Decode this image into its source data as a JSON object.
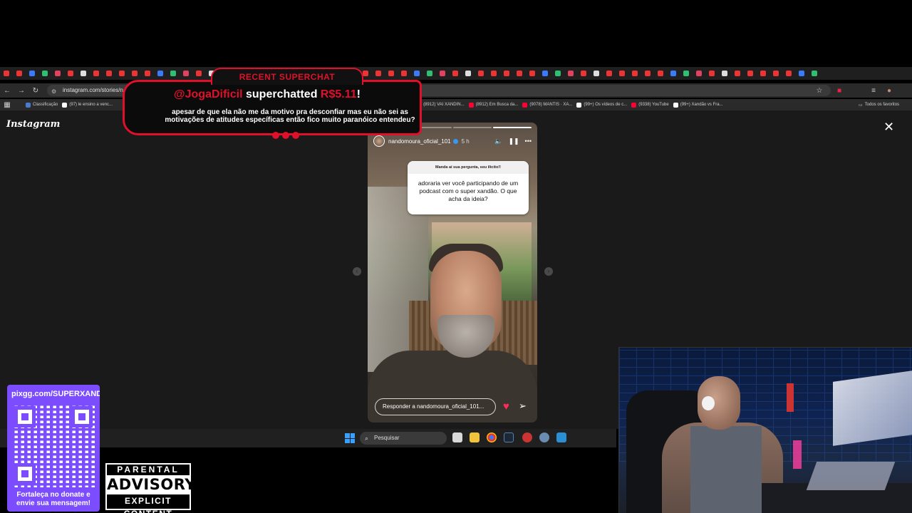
{
  "browser": {
    "url": "instagram.com/stories/n",
    "bookmarks": [
      {
        "label": "Classificação",
        "color": "#4a7bd0"
      },
      {
        "label": "(97) le ensino a venc...",
        "color": "#ffffff"
      },
      {
        "label": "(8912) VAI XANDIN...",
        "color": "#ff0033"
      },
      {
        "label": "(8912) Em Busca da...",
        "color": "#ff0033"
      },
      {
        "label": "(9078) MANTIS · XA...",
        "color": "#ff0033"
      },
      {
        "label": "(99+) Os vídeos de c...",
        "color": "#ffffff"
      },
      {
        "label": "(9338) YouTube",
        "color": "#ff0033"
      },
      {
        "label": "(99+) Xandão vs Fra...",
        "color": "#ffffff"
      }
    ],
    "all_bookmarks": "Todos os favoritos"
  },
  "instagram": {
    "logo": "Instagram",
    "close_icon": "✕",
    "story": {
      "username": "nandomoura_oficial_101",
      "time": "5 h",
      "question_header": "Manda aí sua pergunta, seu iltcito!!",
      "question_text": "adoraria ver você participando de um podcast com o super xandão. O que acha da ideia?",
      "reply_placeholder": "Responder a nandomoura_oficial_101..."
    }
  },
  "superchat": {
    "header": "RECENT SUPERCHAT",
    "user": "@JogaDificil",
    "verb": "superchatted",
    "amount": "R$5.11",
    "exclaim": "!",
    "message": "apesar de que ela não me da motivo pra desconfiar mas eu não sei as motivações de atitudes específicas então fico muito paranóico entendeu?"
  },
  "taskbar": {
    "search_label": "Pesquisar"
  },
  "donate": {
    "url": "pixgg.com/SUPERXANDA",
    "caption": "Fortaleça no donate e envie sua mensagem!"
  },
  "advisory": {
    "line1": "PARENTAL",
    "line2": "ADVISORY",
    "line3": "EXPLICIT CONTENT"
  },
  "colors": {
    "superchat_red": "#e0102a",
    "donate_purple": "#7c4dff",
    "instagram_bg": "#1a1a1a"
  }
}
